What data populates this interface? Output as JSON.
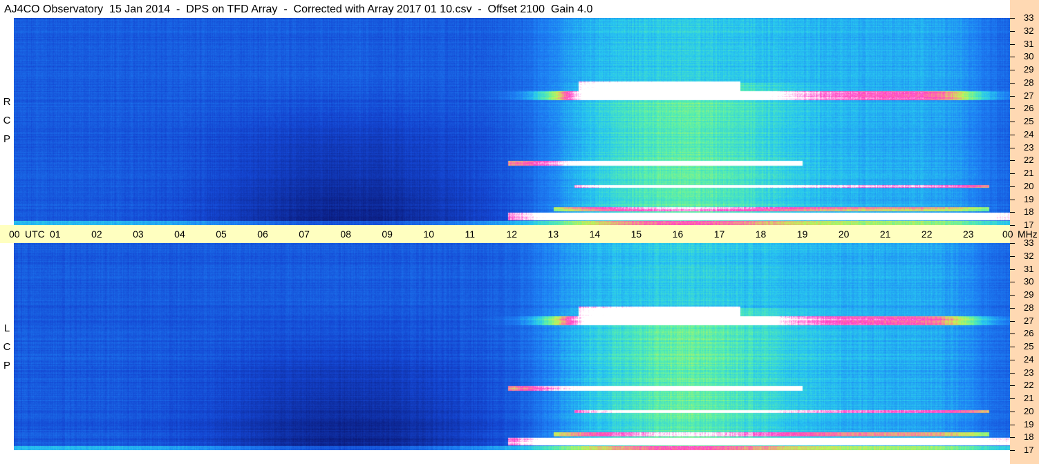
{
  "title": "AJ4CO Observatory  15 Jan 2014  -  DPS on TFD Array  -  Corrected with Array 2017 01 10.csv  -  Offset 2100  Gain 4.0",
  "panels": [
    {
      "name": "rcp",
      "pol_label": "R C P"
    },
    {
      "name": "lcp",
      "pol_label": "L C P"
    }
  ],
  "colors": {
    "background": "#ffffff",
    "time_band": "#ffffc0",
    "freq_axis_bg": "#ffd9b3",
    "spectrogram_low": "#0a2a8c",
    "spectrogram_mid": "#1e78f0",
    "spectrogram_high": "#7fffb0",
    "burst": "#ff40c0",
    "saturated": "#ffffff"
  },
  "chart_data": {
    "type": "heatmap",
    "x_unit_label": "UTC",
    "y_unit_label": "MHz",
    "x_ticks": [
      "00",
      "01",
      "02",
      "03",
      "04",
      "05",
      "06",
      "07",
      "08",
      "09",
      "10",
      "11",
      "12",
      "13",
      "14",
      "15",
      "16",
      "17",
      "18",
      "19",
      "20",
      "21",
      "22",
      "23",
      "00"
    ],
    "y_ticks": [
      "17",
      "18",
      "19",
      "20",
      "21",
      "22",
      "23",
      "24",
      "25",
      "26",
      "27",
      "28",
      "29",
      "30",
      "31",
      "32",
      "33"
    ],
    "xlim": [
      0,
      24
    ],
    "ylim": [
      17,
      33
    ],
    "series": [
      {
        "name": "R C P"
      },
      {
        "name": "L C P"
      }
    ]
  }
}
